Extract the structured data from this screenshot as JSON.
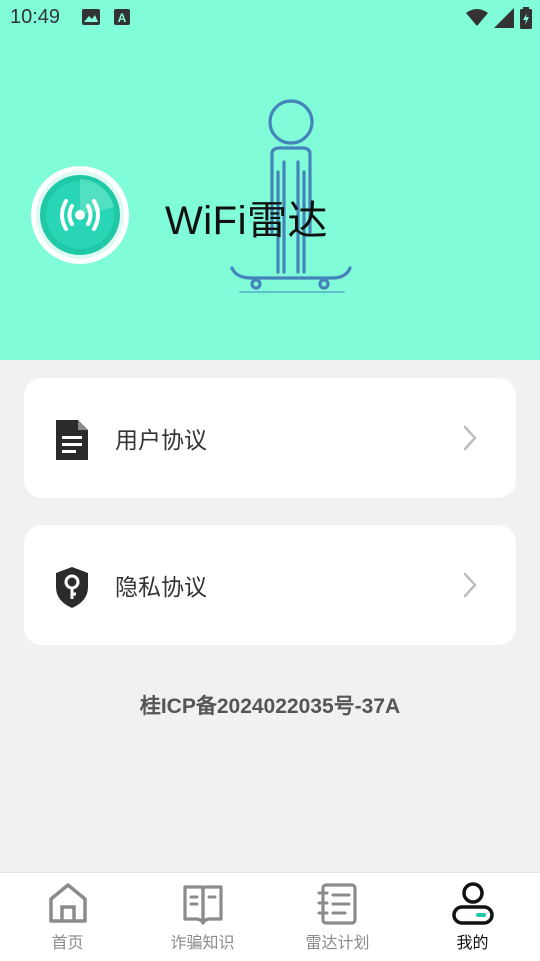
{
  "status_bar": {
    "time": "10:49",
    "left_icons": [
      "image-icon",
      "text-a-icon"
    ],
    "right_icons": [
      "wifi-icon",
      "signal-icon",
      "battery-icon"
    ]
  },
  "header": {
    "app_name": "WiFi雷达",
    "bg_color": "#80fdd8",
    "accent_color": "#1fc9a8"
  },
  "menu": {
    "items": [
      {
        "label": "用户协议",
        "icon": "document-icon"
      },
      {
        "label": "隐私协议",
        "icon": "shield-key-icon"
      }
    ]
  },
  "footer": {
    "icp": "桂ICP备2024022035号-37A"
  },
  "bottom_nav": {
    "items": [
      {
        "label": "首页",
        "icon": "home-icon",
        "active": false
      },
      {
        "label": "诈骗知识",
        "icon": "book-icon",
        "active": false
      },
      {
        "label": "雷达计划",
        "icon": "list-icon",
        "active": false
      },
      {
        "label": "我的",
        "icon": "person-icon",
        "active": true
      }
    ]
  }
}
